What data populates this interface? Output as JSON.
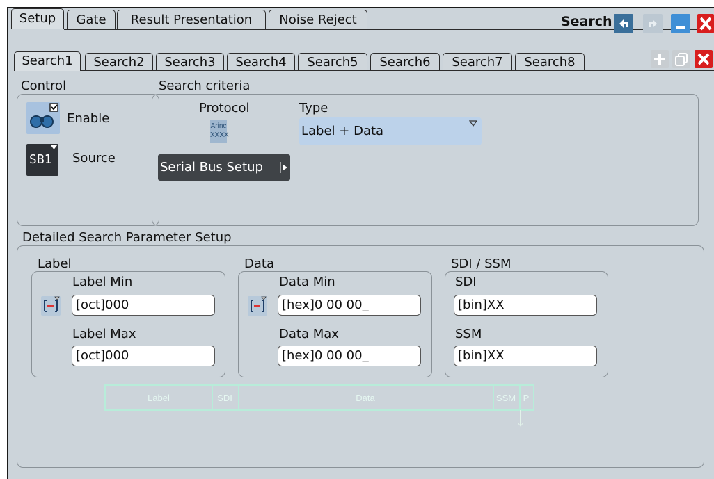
{
  "top_tabs": [
    "Setup",
    "Gate",
    "Result Presentation",
    "Noise Reject"
  ],
  "window_title": "Search",
  "search_tabs": [
    "Search1",
    "Search2",
    "Search3",
    "Search4",
    "Search5",
    "Search6",
    "Search7",
    "Search8"
  ],
  "control": {
    "title": "Control",
    "enable_label": "Enable",
    "source_label": "Source",
    "source_icon_text": "SB1"
  },
  "criteria": {
    "title": "Search criteria",
    "protocol_label": "Protocol",
    "protocol_icon_line1": "Arinc",
    "protocol_icon_line2": "XXXX",
    "type_label": "Type",
    "type_value": "Label + Data",
    "serial_bus_button": "Serial Bus Setup"
  },
  "detail": {
    "title": "Detailed Search Parameter Setup",
    "label_group": {
      "title": "Label",
      "min_label": "Label Min",
      "min_value": "[oct]000",
      "max_label": "Label Max",
      "max_value": "[oct]000"
    },
    "data_group": {
      "title": "Data",
      "min_label": "Data Min",
      "min_value": "[hex]0 00 00_",
      "max_label": "Data Max",
      "max_value": "[hex]0 00 00_"
    },
    "sdi_group": {
      "title": "SDI / SSM",
      "sdi_label": "SDI",
      "sdi_value": "[bin]XX",
      "ssm_label": "SSM",
      "ssm_value": "[bin]XX"
    },
    "diagram": {
      "label": "Label",
      "sdi": "SDI",
      "data": "Data",
      "ssm": "SSM",
      "p": "P"
    }
  },
  "colors": {
    "panel": "#ccd4da",
    "accent_blue": "#3a6f9a",
    "close_red": "#d81e1e",
    "dark_button": "#3f4347",
    "diagram": "#b8ecd9"
  }
}
